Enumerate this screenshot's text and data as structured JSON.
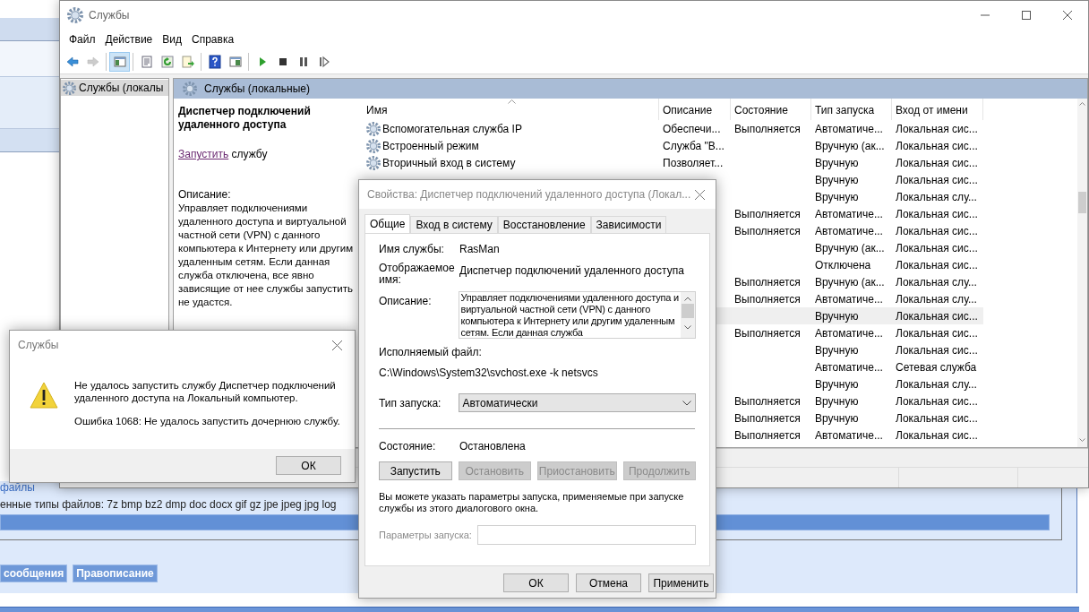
{
  "background_page": {
    "legend": "файлы",
    "file_types": "енные типы файлов: 7z bmp bz2 dmp doc docx gif gz jpe jpeg jpg log",
    "buttons": [
      "сообщения",
      "Правописание"
    ]
  },
  "window": {
    "title": "Службы",
    "menu": [
      "Файл",
      "Действие",
      "Вид",
      "Справка"
    ],
    "toolbar": [
      [
        {
          "kind": "back",
          "disabled": false,
          "pressed": false
        },
        {
          "kind": "forward",
          "disabled": true,
          "pressed": false
        }
      ],
      [
        {
          "kind": "tree_toggle",
          "disabled": false,
          "pressed": true
        }
      ],
      [
        {
          "kind": "properties",
          "disabled": false,
          "pressed": false
        },
        {
          "kind": "refresh",
          "disabled": false,
          "pressed": false
        },
        {
          "kind": "export",
          "disabled": false,
          "pressed": false
        }
      ],
      [
        {
          "kind": "help",
          "disabled": false,
          "pressed": false
        },
        {
          "kind": "console",
          "disabled": false,
          "pressed": false
        }
      ],
      [
        {
          "kind": "start",
          "disabled": false,
          "pressed": false
        },
        {
          "kind": "stop",
          "disabled": false,
          "pressed": false
        },
        {
          "kind": "pause",
          "disabled": false,
          "pressed": false
        },
        {
          "kind": "resume",
          "disabled": false,
          "pressed": false
        }
      ]
    ],
    "tree": [
      {
        "label": "Службы (локалы",
        "selected": true
      }
    ],
    "pane_title": "Службы (локальные)",
    "details": {
      "service_name": "Диспетчер подключений удаленного доступа",
      "action_link": "Запустить",
      "action_text": "службу",
      "description_label": "Описание:",
      "description": "Управляет подключениями удаленного доступа и виртуальной частной сети (VPN) с данного компьютера к Интернету или другим удаленным сетям. Если данная служба отключена, все явно зависящие от нее службы запустить не удастся."
    },
    "table": {
      "columns": [
        "Имя",
        "Описание",
        "Состояние",
        "Тип запуска",
        "Вход от имени"
      ],
      "rows": [
        {
          "name": "Вспомогательная служба IP",
          "description": "Обеспечи...",
          "state": "Выполняется",
          "startup": "Автоматиче...",
          "logon": "Локальная сис...",
          "selected": false
        },
        {
          "name": "Встроенный режим",
          "description": "Служба \"В...",
          "startup": "Вручную (ак...",
          "logon": "Локальная сис...",
          "selected": false
        },
        {
          "name": "Вторичный вход в систему",
          "description": "Позволяет...",
          "startup": "Вручную",
          "logon": "Локальная сис...",
          "selected": false
        },
        {
          "startup": "Вручную",
          "logon": "Локальная сис...",
          "selected": false
        },
        {
          "startup": "Вручную",
          "logon": "Локальная слу...",
          "selected": false
        },
        {
          "state": "Выполняется",
          "startup": "Автоматиче...",
          "logon": "Локальная сис...",
          "selected": false
        },
        {
          "state": "Выполняется",
          "startup": "Автоматиче...",
          "logon": "Локальная сис...",
          "selected": false
        },
        {
          "startup": "Вручную (ак...",
          "logon": "Локальная сис...",
          "selected": false
        },
        {
          "startup": "Отключена",
          "logon": "Локальная сис...",
          "selected": false
        },
        {
          "state": "Выполняется",
          "startup": "Вручную (ак...",
          "logon": "Локальная слу...",
          "selected": false
        },
        {
          "state": "Выполняется",
          "startup": "Автоматиче...",
          "logon": "Локальная слу...",
          "selected": false
        },
        {
          "startup": "Вручную",
          "logon": "Локальная сис...",
          "selected": true
        },
        {
          "state": "Выполняется",
          "startup": "Автоматиче...",
          "logon": "Локальная сис...",
          "selected": false
        },
        {
          "startup": "Вручную",
          "logon": "Локальная сис...",
          "selected": false
        },
        {
          "startup": "Автоматиче...",
          "logon": "Сетевая служба",
          "selected": false
        },
        {
          "startup": "Вручную",
          "logon": "Локальная слу...",
          "selected": false
        },
        {
          "state": "Выполняется",
          "startup": "Вручную",
          "logon": "Локальная сис...",
          "selected": false
        },
        {
          "state": "Выполняется",
          "startup": "Вручную",
          "logon": "Локальная сис...",
          "selected": false
        },
        {
          "state": "Выполняется",
          "startup": "Автоматиче...",
          "logon": "Локальная сис...",
          "selected": false
        }
      ]
    }
  },
  "error_dialog": {
    "title": "Службы",
    "message": "Не удалось запустить службу Диспетчер подключений удаленного доступа на Локальный компьютер.",
    "error": "Ошибка 1068: Не удалось запустить дочернюю службу.",
    "button": "ОК"
  },
  "properties_dialog": {
    "title": "Свойства: Диспетчер подключений удаленного доступа (Локал...",
    "tabs": [
      {
        "label": "Общие",
        "selected": true
      },
      {
        "label": "Вход в систему",
        "selected": false
      },
      {
        "label": "Восстановление",
        "selected": false
      },
      {
        "label": "Зависимости",
        "selected": false
      }
    ],
    "service_name_label": "Имя службы:",
    "service_name": "RasMan",
    "display_name_label": "Отображаемое имя:",
    "display_name": "Диспетчер подключений удаленного доступа",
    "description_label": "Описание:",
    "description": "Управляет подключениями удаленного доступа и виртуальной частной сети (VPN) с данного компьютера к Интернету или другим удаленным сетям. Если данная служба",
    "executable_label": "Исполняемый файл:",
    "executable": "C:\\Windows\\System32\\svchost.exe -k netsvcs",
    "startup_label": "Тип запуска:",
    "startup": "Автоматически",
    "status_label": "Состояние:",
    "status": "Остановлена",
    "service_buttons": [
      {
        "label": "Запустить",
        "disabled": false
      },
      {
        "label": "Остановить",
        "disabled": true
      },
      {
        "label": "Приостановить",
        "disabled": true
      },
      {
        "label": "Продолжить",
        "disabled": true
      }
    ],
    "hint": "Вы можете указать параметры запуска, применяемые при запуске службы из этого диалогового окна.",
    "params_label": "Параметры запуска:",
    "params_disabled": true,
    "buttons": [
      "ОК",
      "Отмена",
      "Применить"
    ]
  }
}
